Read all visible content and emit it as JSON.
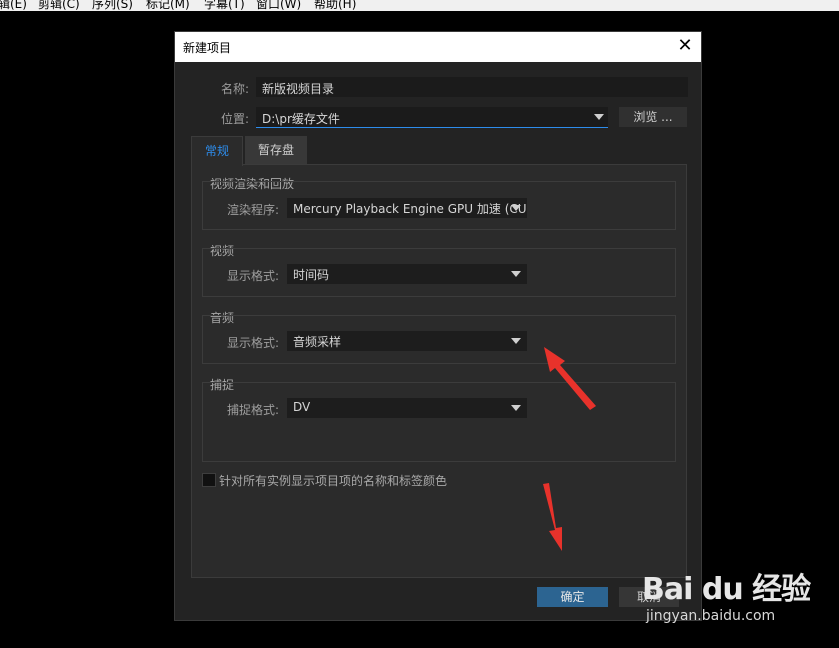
{
  "menubar": {
    "items": [
      "编辑(E)",
      "剪辑(C)",
      "序列(S)",
      "标记(M)",
      "字幕(T)",
      "窗口(W)",
      "帮助(H)"
    ],
    "visible_items": [
      "辑(E)",
      "剪辑(C)",
      "序列(S)",
      "标记(M)",
      "字幕(T)",
      "窗口(W)",
      "帮助(H)"
    ]
  },
  "dialog": {
    "title": "新建项目",
    "close_icon": "close-icon",
    "name_label": "名称:",
    "name_value": "新版视频目录",
    "location_label": "位置:",
    "location_value": "D:\\pr缓存文件",
    "browse_label": "浏览 ...",
    "tabs": [
      {
        "label": "常规",
        "active": true
      },
      {
        "label": "暂存盘",
        "active": false
      }
    ],
    "groups": {
      "render": {
        "title": "视频渲染和回放",
        "field_label": "渲染程序:",
        "value": "Mercury Playback Engine GPU 加速 (CUDA"
      },
      "video": {
        "title": "视频",
        "field_label": "显示格式:",
        "value": "时间码"
      },
      "audio": {
        "title": "音频",
        "field_label": "显示格式:",
        "value": "音频采样"
      },
      "capture": {
        "title": "捕捉",
        "field_label": "捕捉格式:",
        "value": "DV"
      }
    },
    "checkbox_label": "针对所有实例显示项目项的名称和标签颜色",
    "checkbox_checked": false,
    "ok_label": "确定",
    "cancel_label": "取消",
    "accent_color": "#2d8ceb",
    "ok_color": "#2c6491"
  },
  "annotations": {
    "arrow_color": "#e8322b"
  },
  "watermark": {
    "line1": "Bai du 经验",
    "line2": "jingyan.baidu.com"
  }
}
